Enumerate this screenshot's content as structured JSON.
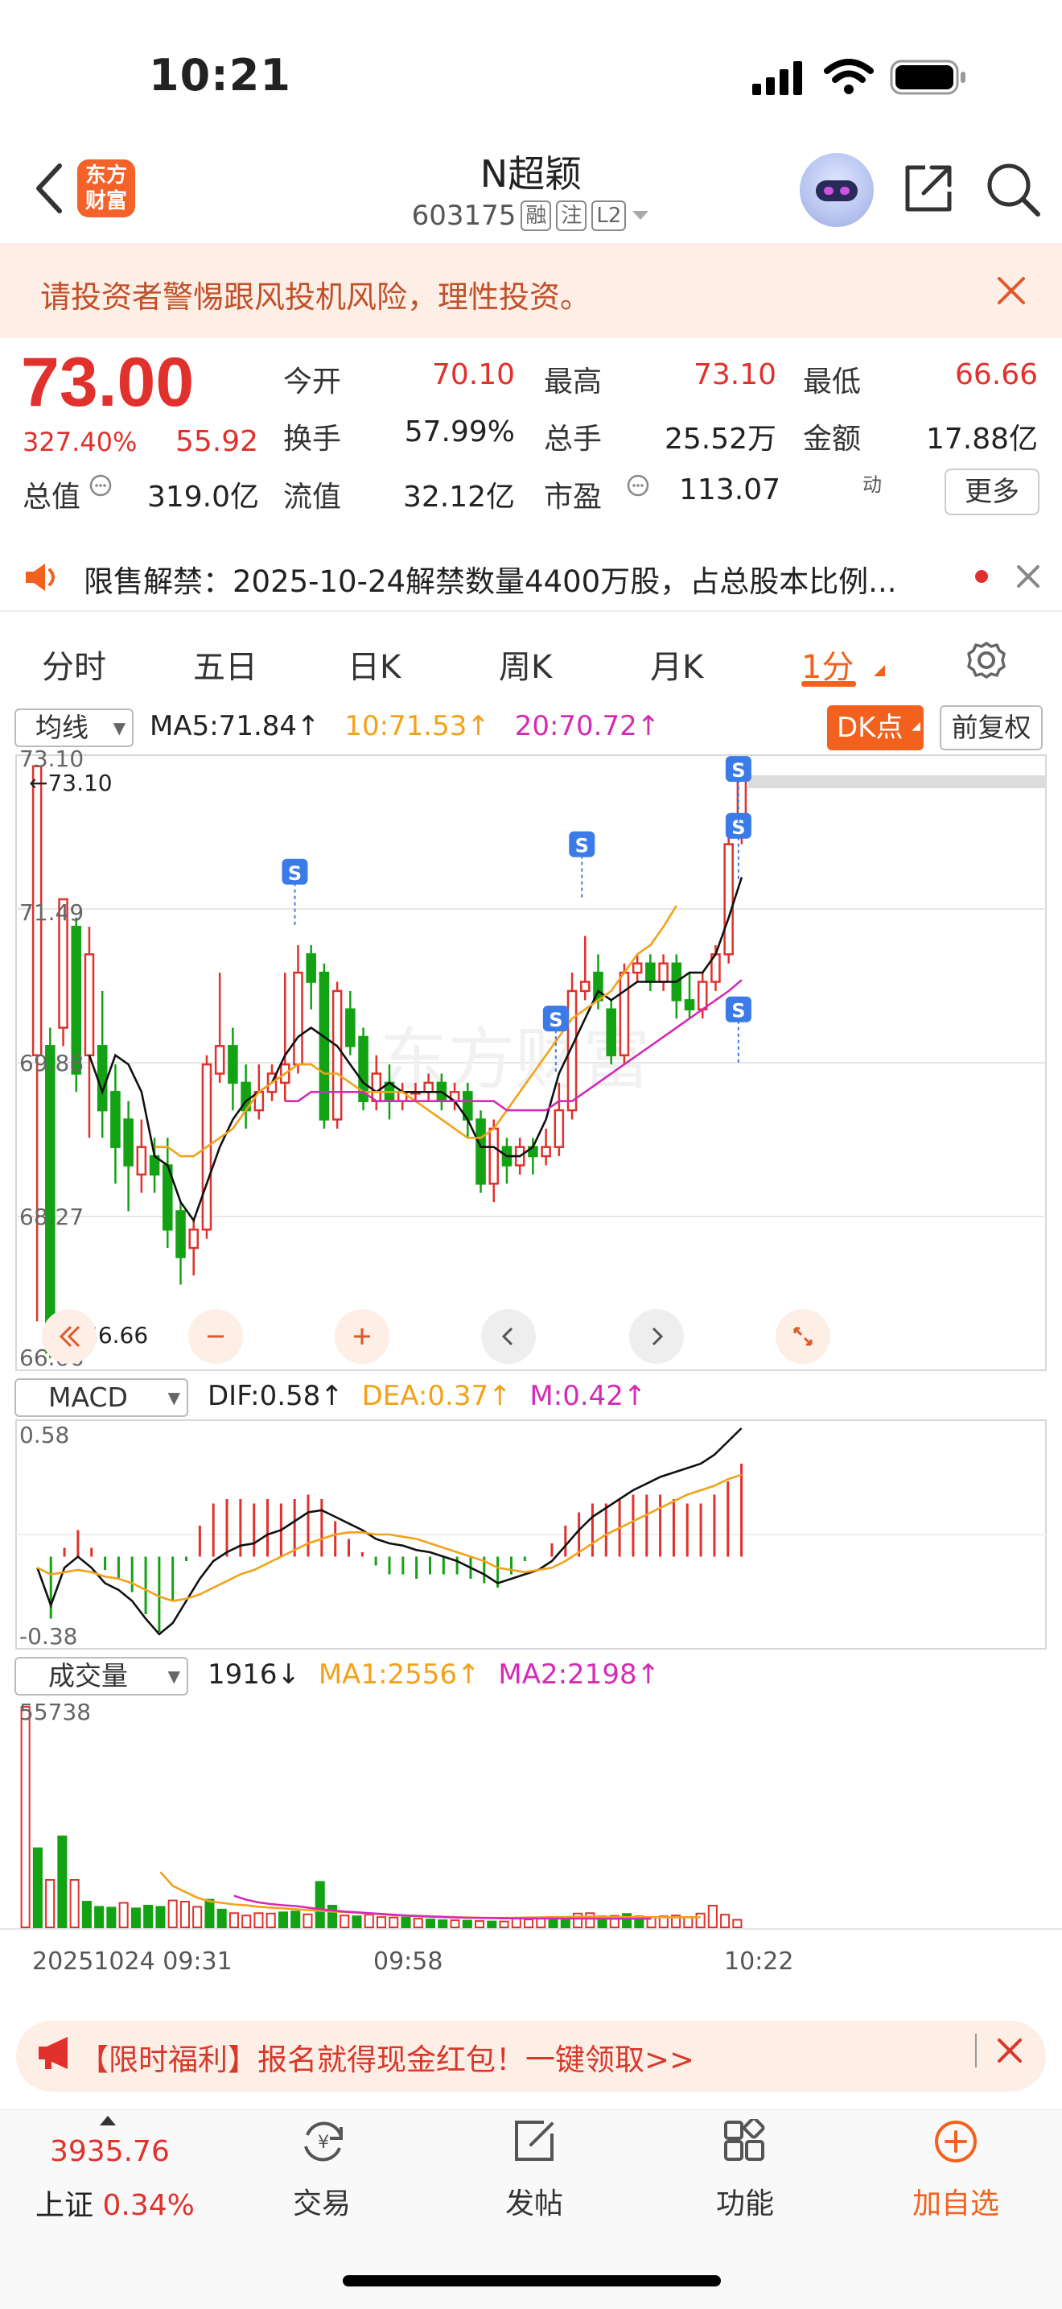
{
  "status_bar": {
    "time": "10:21"
  },
  "header": {
    "logo_line1": "东方",
    "logo_line2": "财富",
    "stock_name": "N超颖",
    "stock_code": "603175",
    "tags": [
      "融",
      "注",
      "L2"
    ]
  },
  "warning": {
    "text": "请投资者警惕跟风投机风险，理性投资。"
  },
  "quote": {
    "price": "73.00",
    "change_pct": "327.40%",
    "change": "55.92",
    "fields": [
      {
        "label": "今开",
        "value": "70.10",
        "color": "#e0312c"
      },
      {
        "label": "最高",
        "value": "73.10",
        "color": "#e0312c"
      },
      {
        "label": "最低",
        "value": "66.66",
        "color": "#e0312c"
      },
      {
        "label": "换手",
        "value": "57.99%",
        "color": "#222222"
      },
      {
        "label": "总手",
        "value": "25.52万",
        "color": "#222222"
      },
      {
        "label": "金额",
        "value": "17.88亿",
        "color": "#222222"
      },
      {
        "label": "总值",
        "value": "319.0亿",
        "color": "#222222"
      },
      {
        "label": "流值",
        "value": "32.12亿",
        "color": "#222222"
      },
      {
        "label": "市盈",
        "value": "113.07",
        "color": "#222222",
        "superscript": "动"
      }
    ],
    "more_label": "更多"
  },
  "notice": {
    "text": "限售解禁：2025-10-24解禁数量4400万股，占总股本比例..."
  },
  "tabs": [
    "分时",
    "五日",
    "日K",
    "周K",
    "月K",
    "1分"
  ],
  "active_tab": "1分",
  "main_chart": {
    "indicator_select": "均线",
    "ma5_label": "MA5:71.84",
    "ma10_label": "10:71.53",
    "ma20_label": "20:70.72",
    "dk_label": "DK点",
    "adjust_label": "前复权",
    "y_ticks": [
      "73.10",
      "71.49",
      "69.88",
      "68.27",
      "66.66"
    ],
    "high_marker": "←73.10",
    "low_marker": "66.66",
    "s_marker": "S"
  },
  "macd_chart": {
    "indicator_select": "MACD",
    "dif_label": "DIF:0.58",
    "dea_label": "DEA:0.37",
    "m_label": "M:0.42",
    "y_top": "0.58",
    "y_bottom": "-0.38"
  },
  "volume_chart": {
    "indicator_select": "成交量",
    "vol_label": "1916",
    "ma1_label": "MA1:2556",
    "ma2_label": "MA2:2198",
    "y_top": "55738"
  },
  "time_axis": [
    "20251024 09:31",
    "09:58",
    "10:22"
  ],
  "promo": {
    "text": "【限时福利】报名就得现金红包！一键领取>>"
  },
  "bottom_nav": {
    "index_value": "3935.76",
    "index_name": "上证",
    "index_pct": "0.34%",
    "items": [
      "交易",
      "发帖",
      "功能",
      "加自选"
    ]
  },
  "colors": {
    "up": "#e0312c",
    "down": "#13a213",
    "accent": "#f2621e",
    "ma10": "#f2a21a",
    "ma20": "#d42bb6"
  },
  "chart_data": {
    "type": "candlestick",
    "ylim": [
      66.66,
      73.1
    ],
    "candles": [
      [
        69.9,
        73.05,
        69.9,
        67.0
      ],
      [
        70.0,
        66.66,
        66.6,
        70.2
      ],
      [
        70.2,
        71.6,
        70.0,
        71.5
      ],
      [
        71.3,
        69.7,
        69.5,
        71.4
      ],
      [
        69.9,
        71.0,
        69.0,
        71.3
      ],
      [
        70.0,
        69.3,
        69.0,
        70.6
      ],
      [
        69.5,
        68.9,
        68.5,
        69.8
      ],
      [
        69.2,
        68.7,
        68.2,
        69.4
      ],
      [
        68.6,
        68.9,
        68.4,
        69.2
      ],
      [
        68.8,
        68.6,
        68.4,
        69.0
      ],
      [
        68.7,
        68.0,
        67.8,
        69.0
      ],
      [
        68.2,
        67.7,
        67.4,
        68.3
      ],
      [
        67.8,
        68.0,
        67.5,
        68.1
      ],
      [
        68.0,
        69.8,
        67.9,
        69.9
      ],
      [
        69.7,
        70.0,
        69.6,
        70.8
      ],
      [
        70.0,
        69.6,
        69.3,
        70.2
      ],
      [
        69.6,
        69.3,
        69.1,
        69.8
      ],
      [
        69.3,
        69.5,
        69.2,
        69.8
      ],
      [
        69.5,
        69.7,
        69.4,
        69.8
      ],
      [
        69.6,
        69.8,
        69.4,
        70.8
      ],
      [
        69.8,
        70.8,
        69.7,
        71.1
      ],
      [
        71.0,
        70.7,
        70.4,
        71.1
      ],
      [
        70.8,
        69.2,
        69.1,
        70.9
      ],
      [
        69.2,
        70.6,
        69.1,
        70.7
      ],
      [
        70.4,
        70.0,
        69.9,
        70.6
      ],
      [
        70.1,
        69.4,
        69.3,
        70.2
      ],
      [
        69.4,
        69.7,
        69.3,
        69.9
      ],
      [
        69.6,
        69.4,
        69.2,
        69.8
      ],
      [
        69.4,
        69.5,
        69.3,
        69.6
      ],
      [
        69.5,
        69.5,
        69.4,
        69.6
      ],
      [
        69.5,
        69.6,
        69.4,
        69.7
      ],
      [
        69.6,
        69.4,
        69.3,
        69.7
      ],
      [
        69.4,
        69.5,
        69.3,
        69.6
      ],
      [
        69.5,
        69.2,
        69.0,
        69.6
      ],
      [
        69.2,
        68.5,
        68.4,
        69.3
      ],
      [
        68.5,
        69.1,
        68.3,
        69.2
      ],
      [
        68.9,
        68.7,
        68.5,
        69.0
      ],
      [
        68.7,
        68.9,
        68.6,
        69.0
      ],
      [
        68.9,
        68.8,
        68.6,
        69.0
      ],
      [
        68.8,
        68.9,
        68.7,
        69.1
      ],
      [
        68.9,
        69.3,
        68.8,
        69.6
      ],
      [
        69.3,
        70.6,
        69.2,
        70.8
      ],
      [
        70.6,
        70.7,
        70.5,
        71.2
      ],
      [
        70.8,
        70.5,
        70.4,
        71.0
      ],
      [
        70.4,
        69.9,
        69.8,
        70.5
      ],
      [
        69.9,
        70.8,
        69.8,
        70.9
      ],
      [
        70.8,
        70.9,
        70.7,
        71.0
      ],
      [
        70.9,
        70.7,
        70.6,
        71.0
      ],
      [
        70.7,
        70.9,
        70.6,
        71.0
      ],
      [
        70.9,
        70.5,
        70.3,
        71.0
      ],
      [
        70.5,
        70.4,
        70.3,
        70.8
      ],
      [
        70.4,
        70.7,
        70.3,
        70.8
      ],
      [
        70.7,
        71.0,
        70.6,
        71.1
      ],
      [
        71.0,
        72.2,
        70.9,
        72.3
      ],
      [
        72.3,
        73.0,
        72.2,
        73.1
      ]
    ],
    "ma5": [
      null,
      null,
      null,
      null,
      69.9,
      69.5,
      69.9,
      69.8,
      69.5,
      68.8,
      68.7,
      68.3,
      68.1,
      68.5,
      68.9,
      69.2,
      69.4,
      69.5,
      69.6,
      69.9,
      70.1,
      70.2,
      70.1,
      70.0,
      69.8,
      69.6,
      69.5,
      69.6,
      69.5,
      69.5,
      69.5,
      69.5,
      69.4,
      69.2,
      68.9,
      68.9,
      68.8,
      68.8,
      68.9,
      69.2,
      69.7,
      70.0,
      70.3,
      70.6,
      70.5,
      70.6,
      70.7,
      70.7,
      70.7,
      70.7,
      70.8,
      70.8,
      71.0,
      71.4,
      71.84
    ],
    "ma10": [
      null,
      null,
      null,
      null,
      null,
      null,
      null,
      null,
      null,
      68.9,
      68.9,
      68.8,
      68.8,
      68.9,
      69.0,
      69.1,
      69.3,
      69.5,
      69.6,
      69.7,
      69.8,
      69.8,
      69.7,
      69.7,
      69.6,
      69.5,
      69.5,
      69.5,
      69.5,
      69.4,
      69.3,
      69.2,
      69.1,
      69.0,
      69.0,
      69.1,
      69.3,
      69.5,
      69.7,
      69.9,
      70.1,
      70.3,
      70.4,
      70.5,
      70.6,
      70.8,
      71.0,
      71.1,
      71.3,
      71.53
    ],
    "ma20": [
      null,
      null,
      null,
      null,
      null,
      null,
      null,
      null,
      null,
      null,
      null,
      null,
      null,
      null,
      null,
      null,
      null,
      null,
      null,
      69.4,
      69.4,
      69.5,
      69.5,
      69.5,
      69.5,
      69.5,
      69.4,
      69.4,
      69.4,
      69.4,
      69.4,
      69.4,
      69.4,
      69.4,
      69.4,
      69.4,
      69.3,
      69.3,
      69.3,
      69.3,
      69.4,
      69.4,
      69.5,
      69.6,
      69.7,
      69.8,
      69.9,
      70.0,
      70.1,
      70.2,
      70.3,
      70.4,
      70.5,
      70.6,
      70.72
    ],
    "macd": {
      "ylim": [
        -0.38,
        0.58
      ],
      "dif": [
        -0.05,
        -0.22,
        -0.05,
        0.0,
        -0.05,
        -0.12,
        -0.15,
        -0.2,
        -0.28,
        -0.35,
        -0.3,
        -0.2,
        -0.1,
        -0.02,
        0.02,
        0.05,
        0.06,
        0.1,
        0.12,
        0.16,
        0.2,
        0.21,
        0.18,
        0.15,
        0.12,
        0.08,
        0.06,
        0.05,
        0.03,
        0.02,
        0.0,
        -0.02,
        -0.05,
        -0.08,
        -0.12,
        -0.1,
        -0.08,
        -0.06,
        -0.02,
        0.05,
        0.12,
        0.18,
        0.22,
        0.26,
        0.3,
        0.33,
        0.36,
        0.38,
        0.4,
        0.42,
        0.46,
        0.52,
        0.58
      ],
      "dea": [
        -0.05,
        -0.08,
        -0.07,
        -0.06,
        -0.07,
        -0.09,
        -0.1,
        -0.12,
        -0.15,
        -0.18,
        -0.2,
        -0.19,
        -0.17,
        -0.14,
        -0.11,
        -0.08,
        -0.06,
        -0.03,
        0.0,
        0.03,
        0.06,
        0.08,
        0.1,
        0.11,
        0.11,
        0.1,
        0.1,
        0.09,
        0.08,
        0.06,
        0.04,
        0.02,
        0.0,
        -0.02,
        -0.05,
        -0.06,
        -0.07,
        -0.06,
        -0.05,
        -0.02,
        0.02,
        0.06,
        0.1,
        0.13,
        0.16,
        0.19,
        0.22,
        0.25,
        0.28,
        0.3,
        0.32,
        0.35,
        0.37
      ],
      "m": [
        0.0,
        -0.28,
        0.04,
        0.12,
        0.04,
        -0.06,
        -0.1,
        -0.16,
        -0.26,
        -0.34,
        -0.2,
        -0.02,
        0.14,
        0.24,
        0.26,
        0.26,
        0.24,
        0.26,
        0.24,
        0.26,
        0.28,
        0.26,
        0.16,
        0.08,
        0.02,
        -0.04,
        -0.08,
        -0.08,
        -0.1,
        -0.08,
        -0.08,
        -0.08,
        -0.1,
        -0.12,
        -0.14,
        -0.08,
        -0.02,
        0.0,
        0.06,
        0.14,
        0.2,
        0.24,
        0.24,
        0.26,
        0.28,
        0.28,
        0.28,
        0.26,
        0.24,
        0.24,
        0.28,
        0.34,
        0.42
      ]
    },
    "volume": {
      "ymax": 55738,
      "values": [
        55738,
        20000,
        12000,
        23000,
        12000,
        6500,
        5200,
        5000,
        6200,
        4800,
        5500,
        5200,
        6800,
        6500,
        5200,
        7000,
        4500,
        3600,
        3000,
        3600,
        3500,
        3800,
        4000,
        3300,
        11500,
        5500,
        3000,
        2800,
        3200,
        2600,
        2500,
        2500,
        2200,
        2000,
        1800,
        1800,
        1700,
        1600,
        1500,
        1500,
        2200,
        2000,
        2200,
        2500,
        2400,
        3500,
        3600,
        2800,
        2900,
        3400,
        2800,
        2600,
        2800,
        3000,
        2600,
        3500,
        5500,
        3200,
        1916
      ],
      "ma1": [
        null,
        null,
        null,
        null,
        null,
        null,
        null,
        null,
        null,
        null,
        null,
        14000,
        10500,
        9000,
        7500,
        6600,
        6200,
        5800,
        5600,
        5200,
        5000,
        4800,
        4600,
        4400,
        4200,
        4000,
        3900,
        3700,
        3500,
        3300,
        3100,
        3000,
        2900,
        2800,
        2700,
        2600,
        2500,
        2450,
        2400,
        2400,
        2450,
        2500,
        2550,
        2600,
        2650,
        2700,
        2700,
        2650,
        2600,
        2600,
        2600,
        2600,
        2580,
        2570,
        2560,
        2556
      ],
      "ma2": [
        null,
        null,
        null,
        null,
        null,
        null,
        null,
        null,
        null,
        null,
        null,
        null,
        null,
        null,
        null,
        null,
        null,
        8000,
        7000,
        6300,
        5900,
        5600,
        5400,
        5000,
        4600,
        4300,
        4000,
        3800,
        3600,
        3400,
        3200,
        3000,
        2850,
        2700,
        2600,
        2500,
        2450,
        2400,
        2350,
        2300,
        2280,
        2260,
        2250,
        2240,
        2230,
        2220,
        2210,
        2200,
        2200,
        2200,
        2199,
        2198
      ]
    }
  }
}
